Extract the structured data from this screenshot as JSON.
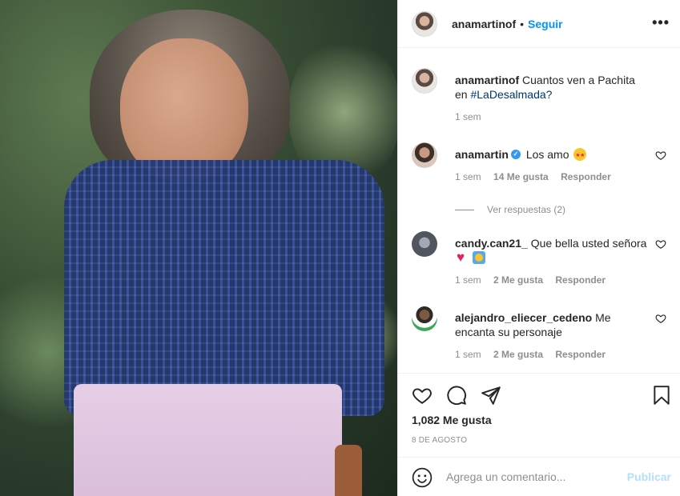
{
  "header": {
    "username": "anamartinof",
    "separator": "•",
    "follow_label": "Seguir",
    "more_icon": "more-options-icon",
    "more_glyph": "•••"
  },
  "caption": {
    "username": "anamartinof",
    "text": "Cuantos ven a Pachita en",
    "hashtag": "#LaDesalmada?",
    "time": "1 sem"
  },
  "comments": [
    {
      "username": "anamartin",
      "verified": true,
      "text": "Los amo",
      "emoji": "star-struck-emoji",
      "time": "1 sem",
      "likes": "14 Me gusta",
      "reply": "Responder",
      "view_replies": "Ver respuestas (2)"
    },
    {
      "username": "candy.can21_",
      "text": "Que bella usted señora",
      "emoji": [
        "red-heart-emoji",
        "hugging-emoji"
      ],
      "time": "1 sem",
      "likes": "2 Me gusta",
      "reply": "Responder"
    },
    {
      "username": "alejandro_eliecer_cedeno",
      "text": "Me encanta su personaje",
      "time": "1 sem",
      "likes": "2 Me gusta",
      "reply": "Responder"
    }
  ],
  "actions": {
    "likes": "1,082 Me gusta",
    "date": "8 DE AGOSTO"
  },
  "add_comment": {
    "placeholder": "Agrega un comentario...",
    "post_label": "Publicar"
  },
  "colors": {
    "accent": "#0095f6",
    "link": "#00376b",
    "muted": "#8e8e8e",
    "post_disabled": "#b2dffc"
  }
}
